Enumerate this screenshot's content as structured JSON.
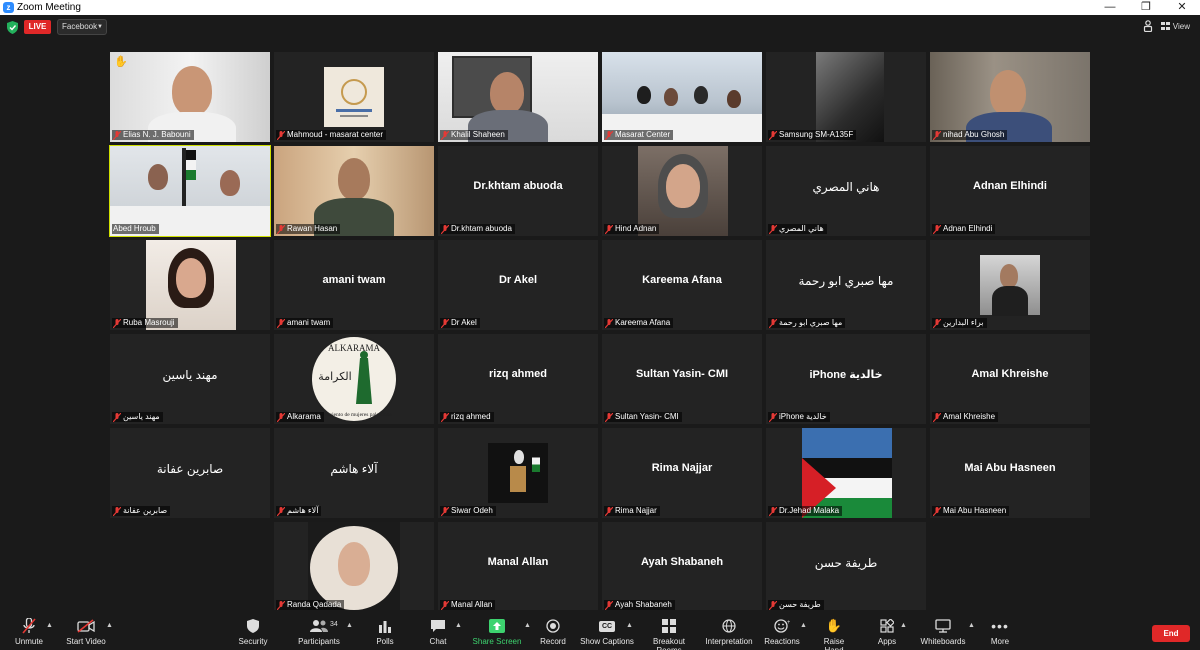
{
  "window": {
    "title": "Zoom Meeting"
  },
  "topbar": {
    "live_label": "LIVE",
    "stream_target": "Facebook",
    "view_label": "View"
  },
  "tiles": [
    {
      "name": "Elias N. J. Babouni",
      "center": "",
      "hand_raised": true
    },
    {
      "name": "Mahmoud - masarat center",
      "center": ""
    },
    {
      "name": "Khalil Shaheen",
      "center": ""
    },
    {
      "name": "Masarat Center",
      "center": ""
    },
    {
      "name": "Samsung SM-A135F",
      "center": ""
    },
    {
      "name": "nihad Abu Ghosh",
      "center": ""
    },
    {
      "name": "Abed Hroub",
      "center": "",
      "active_speaker": true
    },
    {
      "name": "Rawan Hasan",
      "center": ""
    },
    {
      "name": "Dr.khtam abuoda",
      "center": "Dr.khtam abuoda"
    },
    {
      "name": "Hind Adnan",
      "center": ""
    },
    {
      "name": "هاني المصري",
      "center": "هاني المصري"
    },
    {
      "name": "Adnan Elhindi",
      "center": "Adnan Elhindi"
    },
    {
      "name": "Ruba Masrouji",
      "center": ""
    },
    {
      "name": "amani twam",
      "center": "amani twam"
    },
    {
      "name": "Dr Akel",
      "center": "Dr Akel"
    },
    {
      "name": "Kareema Afana",
      "center": "Kareema Afana"
    },
    {
      "name": "مها صبري ابو رحمة",
      "center": "مها صبري ابو رحمة"
    },
    {
      "name": "براء البدارين",
      "center": ""
    },
    {
      "name": "مهند ياسين",
      "center": "مهند ياسين"
    },
    {
      "name": "Alkarama",
      "center": ""
    },
    {
      "name": "rizq ahmed",
      "center": "rizq ahmed"
    },
    {
      "name": "Sultan Yasin- CMI",
      "center": "Sultan Yasin- CMI"
    },
    {
      "name": "iPhone خالدية",
      "center": "iPhone خالدية"
    },
    {
      "name": "Amal Khreishe",
      "center": "Amal Khreishe"
    },
    {
      "name": "صابرين عفانة",
      "center": "صابرين عفانة"
    },
    {
      "name": "آلاء هاشم",
      "center": "آلاء هاشم"
    },
    {
      "name": "Siwar Odeh",
      "center": ""
    },
    {
      "name": "Rima Najjar",
      "center": "Rima Najjar"
    },
    {
      "name": "Dr.Jehad Malaka",
      "center": ""
    },
    {
      "name": "Mai Abu Hasneen",
      "center": "Mai Abu Hasneen"
    },
    {
      "name": "Randa Qadada",
      "center": ""
    },
    {
      "name": "Manal Allan",
      "center": "Manal Allan"
    },
    {
      "name": "Ayah Shabaneh",
      "center": "Ayah Shabaneh"
    },
    {
      "name": "طريفة حسن",
      "center": "طريفة حسن"
    }
  ],
  "toolbar": {
    "unmute": "Unmute",
    "start_video": "Start Video",
    "security": "Security",
    "participants": "Participants",
    "participant_count": "34",
    "polls": "Polls",
    "chat": "Chat",
    "share_screen": "Share Screen",
    "record": "Record",
    "show_captions": "Show Captions",
    "breakout_rooms": "Breakout Rooms",
    "interpretation": "Interpretation",
    "reactions": "Reactions",
    "raise_hand": "Raise Hand",
    "apps": "Apps",
    "whiteboards": "Whiteboards",
    "more": "More",
    "end": "End",
    "cc_badge": "CC"
  },
  "logos": {
    "alkarama_top": "ALKARAMA",
    "alkarama_arabic": "الكرامة",
    "alkarama_bottom": "movimiento de mujeres palestinas"
  },
  "colors": {
    "accent": "#2D8CFF",
    "live_red": "#e02828",
    "share_green": "#3dd36f",
    "active_border": "#cfe000",
    "end_red": "#e02828"
  }
}
